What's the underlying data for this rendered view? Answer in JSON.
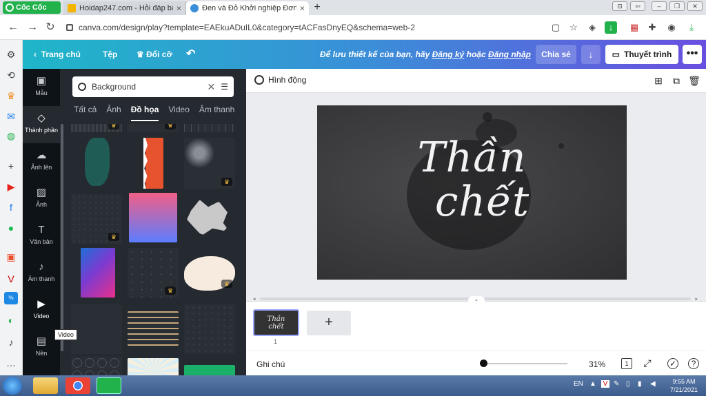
{
  "browser": {
    "logo_text": "Cốc Cốc",
    "tabs": [
      {
        "title": "Hoidap247.com - Hỏi đáp bà",
        "close": "×"
      },
      {
        "title": "Đen và Đỏ Khởi nghiệp Đơn",
        "close": "×"
      }
    ],
    "new_tab": "+",
    "url": "canva.com/design/play?template=EAEkuADuIL0&category=tACFasDnyEQ&schema=web-2"
  },
  "canva_header": {
    "home": "Trang chủ",
    "file": "Tệp",
    "resize": "Đổi cỡ",
    "undo": "↶",
    "save_msg_prefix": "Để lưu thiết kế của bạn, hãy",
    "signup": "Đăng ký",
    "or": "hoặc",
    "login": "Đăng nhập",
    "share": "Chia sẻ",
    "download": "↓",
    "present": "Thuyết trình",
    "more": "•••"
  },
  "rail": [
    {
      "label": "Mẫu",
      "icon": "▣"
    },
    {
      "label": "Thành phần",
      "icon": "◇"
    },
    {
      "label": "Ảnh lên",
      "icon": "☁"
    },
    {
      "label": "Ảnh",
      "icon": "▨"
    },
    {
      "label": "Văn bản",
      "icon": "T"
    },
    {
      "label": "Âm thanh",
      "icon": "♪"
    },
    {
      "label": "Video",
      "icon": "▶"
    },
    {
      "label": "Nền",
      "icon": "▤"
    }
  ],
  "panel": {
    "search_value": "Background",
    "tabs": [
      "Tất cả",
      "Ảnh",
      "Đồ họa",
      "Video",
      "Âm thanh"
    ],
    "active_tab": "Đồ họa"
  },
  "tooltip": "Video",
  "editor": {
    "animate": "Hình động",
    "canvas_line1": "Thần",
    "canvas_line2": "chết",
    "thumb_line1": "Thần",
    "thumb_line2": "chết",
    "page_number": "1",
    "add_page": "+",
    "notes": "Ghi chú",
    "zoom": "31%",
    "page_indicator": "1",
    "zoom_fraction": 0.02
  },
  "taskbar": {
    "lang": "EN",
    "time": "9:55 AM",
    "date": "7/21/2021"
  },
  "colors": {
    "header_start": "#1fb6c9",
    "header_end": "#6a4fe0",
    "rail_bg": "#0e1318",
    "panel_bg": "#252a31"
  }
}
